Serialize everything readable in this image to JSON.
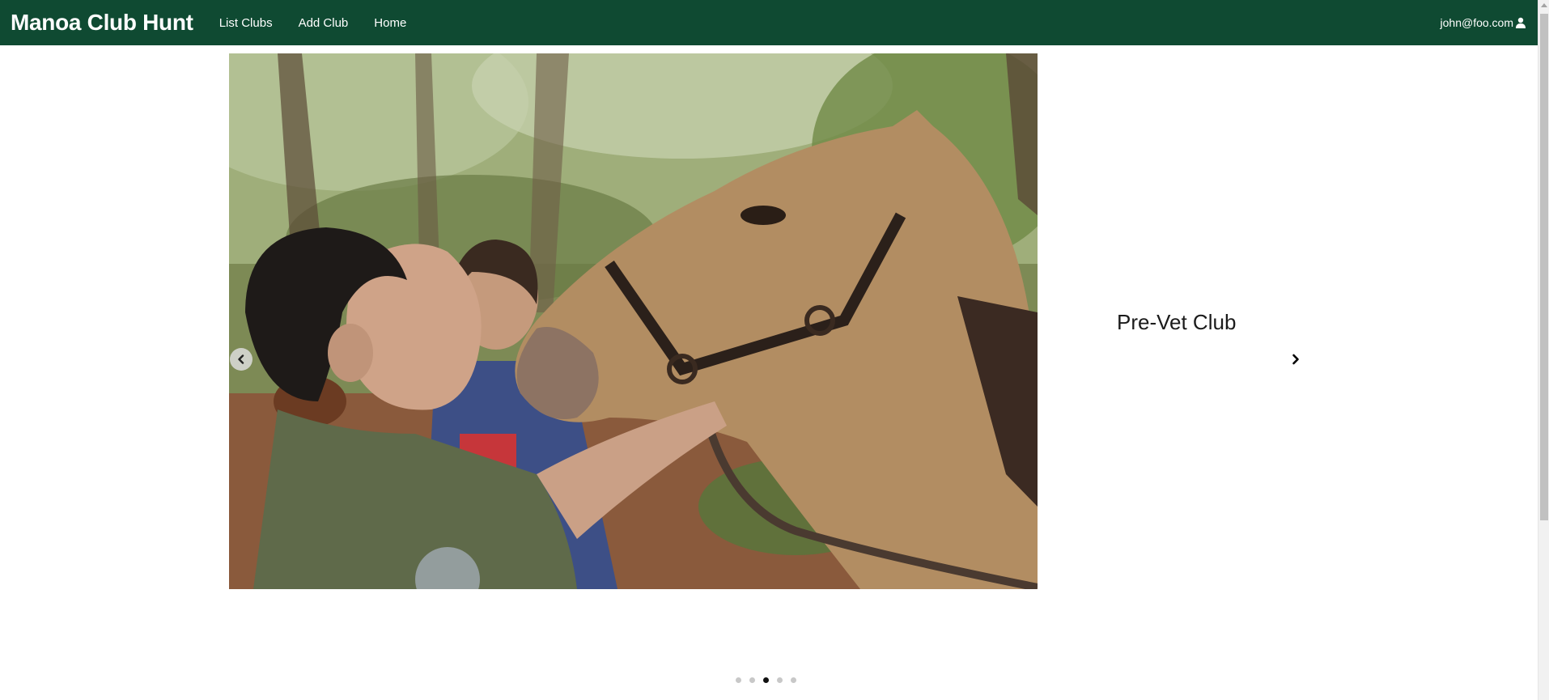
{
  "navbar": {
    "brand": "Manoa Club Hunt",
    "links": [
      {
        "label": "List Clubs"
      },
      {
        "label": "Add Club"
      },
      {
        "label": "Home"
      }
    ],
    "user": "john@foo.com",
    "user_icon": "user-icon",
    "background_color": "#0f4a32"
  },
  "carousel": {
    "slide_title": "Pre-Vet Club",
    "prev_icon": "chevron-left-icon",
    "next_icon": "chevron-right-icon",
    "slide_count": 5,
    "active_index": 2
  }
}
